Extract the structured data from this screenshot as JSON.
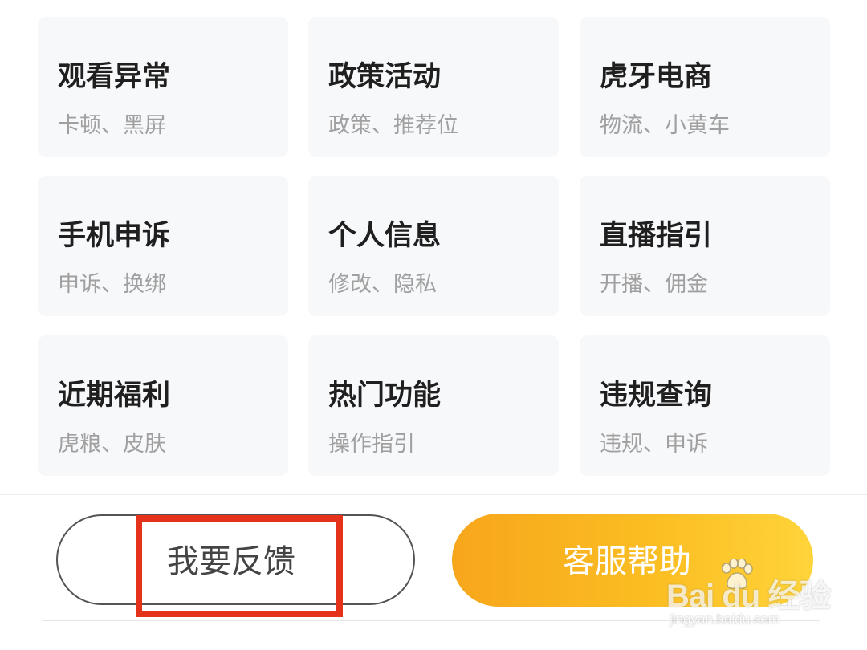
{
  "categories": [
    {
      "title": "观看异常",
      "subtitle": "卡顿、黑屏"
    },
    {
      "title": "政策活动",
      "subtitle": "政策、推荐位"
    },
    {
      "title": "虎牙电商",
      "subtitle": "物流、小黄车"
    },
    {
      "title": "手机申诉",
      "subtitle": "申诉、换绑"
    },
    {
      "title": "个人信息",
      "subtitle": "修改、隐私"
    },
    {
      "title": "直播指引",
      "subtitle": "开播、佣金"
    },
    {
      "title": "近期福利",
      "subtitle": "虎粮、皮肤"
    },
    {
      "title": "热门功能",
      "subtitle": "操作指引"
    },
    {
      "title": "违规查询",
      "subtitle": "违规、申诉"
    }
  ],
  "actions": {
    "feedback_label": "我要反馈",
    "help_label": "客服帮助"
  },
  "watermark": {
    "logo_text": "Bai du 经验",
    "url": "jingyan.baidu.com"
  },
  "colors": {
    "accent_orange": "#fbbd22",
    "highlight_red": "#e4321b",
    "card_bg": "#f7f8fa"
  }
}
